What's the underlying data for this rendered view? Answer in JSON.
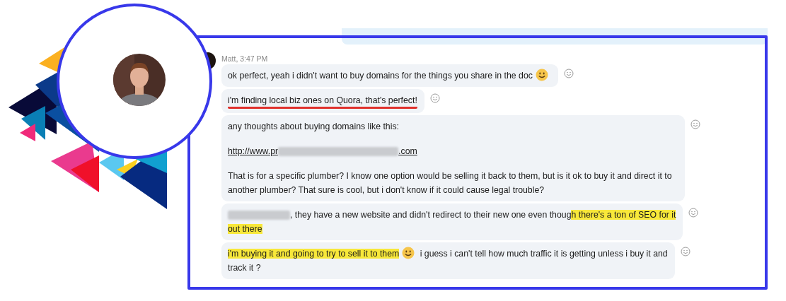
{
  "sender": {
    "label": "Matt, 3:47 PM"
  },
  "messages": [
    {
      "underlined": false,
      "paragraphs": [
        [
          [
            {
              "kind": "text",
              "text": "ok perfect, yeah i didn't want to buy domains for the things you share in the doc",
              "highlighted": false
            },
            {
              "kind": "emoji"
            }
          ]
        ]
      ]
    },
    {
      "underlined": true,
      "paragraphs": [
        [
          [
            {
              "kind": "text",
              "text": "i'm finding local biz ones on Quora, that's perfect!",
              "highlighted": false
            }
          ]
        ]
      ]
    },
    {
      "underlined": false,
      "paragraphs": [
        [
          [
            {
              "kind": "text",
              "text": "any thoughts about buying domains like this:",
              "highlighted": false
            }
          ]
        ],
        [
          [
            {
              "kind": "link",
              "text": "http://www.pr"
            },
            {
              "kind": "blur"
            },
            {
              "kind": "link",
              "text": ".com"
            }
          ]
        ],
        [
          [
            {
              "kind": "text",
              "text": "That is for a specific plumber?  I know one option would be selling it back to them, but is it ok to buy it and direct it to another plumber?  That sure is cool, but i don't know if it could cause legal trouble?",
              "highlighted": false
            }
          ]
        ]
      ]
    },
    {
      "underlined": false,
      "paragraphs": [
        [
          [
            {
              "kind": "blur"
            },
            {
              "kind": "text",
              "text": ", they have a new website and didn't redirect to their new one even thoug",
              "highlighted": false
            },
            {
              "kind": "text",
              "text": "h there's a ton of SEO for it",
              "highlighted": true
            }
          ],
          [
            {
              "kind": "text",
              "text": "out there",
              "highlighted": true
            }
          ]
        ]
      ]
    },
    {
      "underlined": false,
      "paragraphs": [
        [
          [
            {
              "kind": "text",
              "text": "i'm buying it and going to try to sell it to them",
              "highlighted": true
            },
            {
              "kind": "emoji"
            },
            {
              "kind": "text",
              "text": " i guess i can't tell how much traffic it is getting unless i buy it and",
              "highlighted": false
            }
          ],
          [
            {
              "kind": "text",
              "text": "track it ?",
              "highlighted": false
            }
          ]
        ]
      ]
    }
  ]
}
